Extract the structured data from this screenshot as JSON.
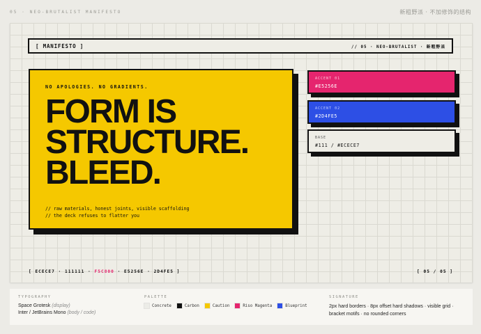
{
  "header": {
    "left": "05 · NEO-BRUTALIST MANIFESTO",
    "right": "新粗野派 · 不加修饰的结构"
  },
  "slide": {
    "title_left": "[ MANIFESTO ]",
    "title_right": "// 05 · NEO-BRUTALIST · 新粗野派",
    "kicker": "NO APOLOGIES. NO GRADIENTS.",
    "headline": [
      "FORM IS",
      "STRUCTURE.",
      "BLEED."
    ],
    "notes": [
      "// raw materials, honest joints, visible scaffolding",
      "// the deck refuses to flatter you"
    ],
    "swatches": [
      {
        "label": "ACCENT 01",
        "hex": "#E5256E",
        "color": "#e5256e"
      },
      {
        "label": "ACCENT 02",
        "hex": "#2D4FE5",
        "color": "#2d4fe5"
      },
      {
        "label": "BASE",
        "hex": "#111 / #ECECE7",
        "color": "#eeede6"
      }
    ],
    "footer_codes": {
      "pre": "[ ECECE7 · 111111 · ",
      "highlight": "F5C800",
      "post": " · E5256E · 2D4FE5 ]"
    },
    "page": "[ 05 / 05 ]"
  },
  "info": {
    "typography": {
      "heading": "TYPOGRAPHY",
      "line1": "Space Grotesk",
      "line1_role": "(display)",
      "line2": "Inter / JetBrains Mono",
      "line2_role": "(body / code)"
    },
    "palette": {
      "heading": "PALETTE",
      "items": [
        {
          "name": "Concrete",
          "color": "#ecece7"
        },
        {
          "name": "Carbon",
          "color": "#111111"
        },
        {
          "name": "Caution",
          "color": "#f5c800"
        },
        {
          "name": "Riso Magenta",
          "color": "#e5256e"
        },
        {
          "name": "Blueprint",
          "color": "#2d4fe5"
        }
      ]
    },
    "signature": {
      "heading": "SIGNATURE",
      "text": "2px hard borders · 8px offset hard shadows · visible grid · bracket motifs · no rounded corners"
    }
  }
}
